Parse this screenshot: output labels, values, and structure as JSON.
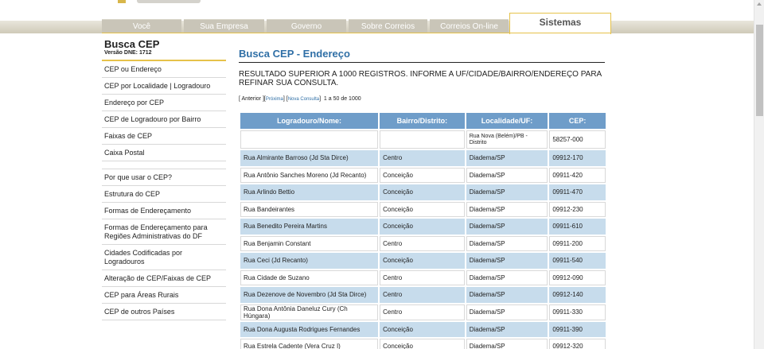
{
  "nav": {
    "tabs": [
      {
        "label": "Você"
      },
      {
        "label": "Sua Empresa"
      },
      {
        "label": "Governo"
      },
      {
        "label": "Sobre Correios"
      },
      {
        "label": "Correios On-line"
      },
      {
        "label": "Sistemas",
        "active": true
      }
    ]
  },
  "sidebar": {
    "title": "Busca CEP",
    "version": "Versão DNE: 1712",
    "group1": [
      "CEP ou Endereço",
      "CEP por Localidade | Logradouro",
      "Endereço por CEP",
      "CEP de Logradouro por Bairro",
      "Faixas de CEP",
      "Caixa Postal"
    ],
    "group2": [
      "Por que usar o CEP?",
      "Estrutura do CEP",
      "Formas de Endereçamento",
      "Formas de Endereçamento para Regiões Administrativas do DF",
      "Cidades Codificadas por Logradouros",
      "Alteração de CEP/Faixas de CEP",
      "CEP para Áreas Rurais",
      "CEP de outros Países"
    ]
  },
  "main": {
    "title": "Busca CEP - Endereço",
    "message": "RESULTADO SUPERIOR A 1000 REGISTROS. INFORME A UF/CIDADE/BAIRRO/ENDEREÇO PARA REFINAR SUA CONSULTA.",
    "pager": {
      "prev": "[ Anterior ]",
      "open": "[",
      "next": "Próxima",
      "mid": "] [",
      "new": "Nova Consulta",
      "close": "]",
      "range": "1 a 50 de 1000"
    },
    "headers": [
      "Logradouro/Nome:",
      "Bairro/Distrito:",
      "Localidade/UF:",
      "CEP:"
    ],
    "rows": [
      [
        "",
        "",
        "Rua Nova (Belém)/PB - Distrito",
        "58257-000"
      ],
      [
        "Rua Almirante Barroso (Jd Sta Dirce)",
        "Centro",
        "Diadema/SP",
        "09912-170"
      ],
      [
        "Rua Antônio Sanches Moreno (Jd Recanto)",
        "Conceição",
        "Diadema/SP",
        "09911-420"
      ],
      [
        "Rua Arlindo Bettio",
        "Conceição",
        "Diadema/SP",
        "09911-470"
      ],
      [
        "Rua Bandeirantes",
        "Conceição",
        "Diadema/SP",
        "09912-230"
      ],
      [
        "Rua Benedito Pereira Martins",
        "Conceição",
        "Diadema/SP",
        "09911-610"
      ],
      [
        "Rua Benjamin Constant",
        "Centro",
        "Diadema/SP",
        "09911-200"
      ],
      [
        "Rua Ceci (Jd Recanto)",
        "Conceição",
        "Diadema/SP",
        "09911-540"
      ],
      [
        "Rua Cidade de Suzano",
        "Centro",
        "Diadema/SP",
        "09912-090"
      ],
      [
        "Rua Dezenove de Novembro (Jd Sta Dirce)",
        "Centro",
        "Diadema/SP",
        "09912-140"
      ],
      [
        "Rua Dona Antônia Daneluz Cury (Ch Húngara)",
        "Centro",
        "Diadema/SP",
        "09911-330"
      ],
      [
        "Rua Dona Augusta Rodrigues Fernandes",
        "Conceição",
        "Diadema/SP",
        "09911-390"
      ],
      [
        "Rua Estrela Cadente (Vera Cruz I)",
        "Conceição",
        "Diadema/SP",
        "09912-320"
      ]
    ]
  }
}
